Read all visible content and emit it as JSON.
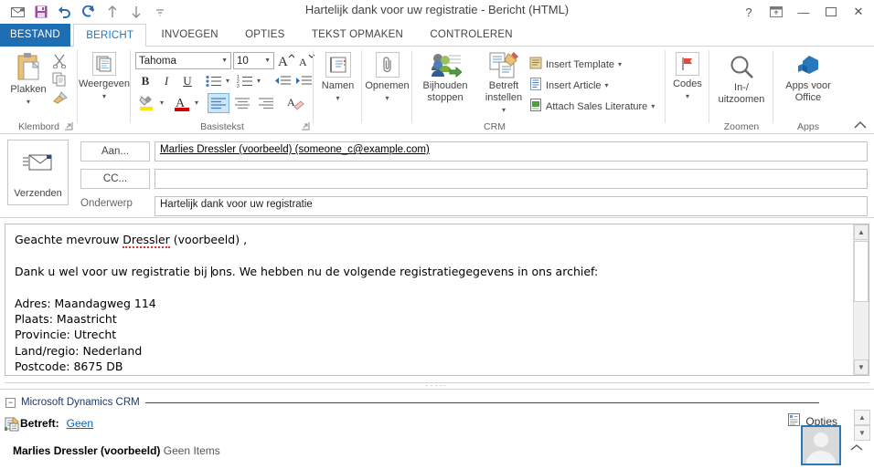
{
  "window": {
    "title": "Hartelijk dank voor uw registratie - Bericht (HTML)",
    "quick_access": [
      {
        "name": "message-icon",
        "glyph": "✉"
      },
      {
        "name": "save-icon",
        "glyph": "▣"
      },
      {
        "name": "undo-icon",
        "glyph": "↶"
      },
      {
        "name": "redo-icon",
        "glyph": "↻"
      },
      {
        "name": "previous-item-icon",
        "glyph": "↑"
      },
      {
        "name": "next-item-icon",
        "glyph": "↓"
      },
      {
        "name": "customize-quick-access-icon",
        "glyph": "⨍"
      }
    ],
    "controls": {
      "help": "?",
      "ribbon_display": "⧉",
      "minimize": "—",
      "maximize": "❐",
      "close": "✕"
    }
  },
  "tabs": {
    "file": "BESTAND",
    "items": [
      {
        "label": "BERICHT",
        "active": true
      },
      {
        "label": "INVOEGEN",
        "active": false
      },
      {
        "label": "OPTIES",
        "active": false
      },
      {
        "label": "TEKST OPMAKEN",
        "active": false
      },
      {
        "label": "CONTROLEREN",
        "active": false
      }
    ]
  },
  "ribbon": {
    "clipboard": {
      "group_label": "Klembord",
      "paste_label": "Plakken",
      "cut_label": "Knippen",
      "copy_label": "Kopiëren",
      "format_painter_label": "Opmaak kopiëren/plakken",
      "dialog_launcher": "⤵"
    },
    "show": {
      "button_label": "Weergeven"
    },
    "basic_text": {
      "group_label": "Basistekst",
      "font_name": "Tahoma",
      "font_size": "10",
      "grow_font": "A",
      "shrink_font": "A",
      "bold": "B",
      "italic": "I",
      "underline": "U",
      "bullets": "bullet-list",
      "numbering": "numbered-list",
      "decrease_indent": "decrease-indent",
      "increase_indent": "increase-indent",
      "highlight": "text-highlight",
      "font_color": "A",
      "align_left": "align-left",
      "align_center": "align-center",
      "align_right": "align-right",
      "clear_formatting": "clear-formatting",
      "dialog_launcher": "⤵"
    },
    "names": {
      "button_label": "Namen"
    },
    "include": {
      "button_label": "Opnemen"
    },
    "crm": {
      "group_label": "CRM",
      "track_label_line1": "Bijhouden",
      "track_label_line2": "stoppen",
      "regarding_line1": "Betreft",
      "regarding_line2": "instellen",
      "items": [
        {
          "label": "Insert Template",
          "icon": "template-icon"
        },
        {
          "label": "Insert Article",
          "icon": "article-icon"
        },
        {
          "label": "Attach Sales Literature",
          "icon": "sales-literature-icon"
        }
      ],
      "codes_label": "Codes"
    },
    "zoom": {
      "group_label": "Zoomen",
      "button_line1": "In-/",
      "button_line2": "uitzoomen"
    },
    "apps": {
      "group_label": "Apps",
      "button_line1": "Apps voor",
      "button_line2": "Office"
    },
    "collapse_ribbon": "⌃"
  },
  "compose": {
    "send_label": "Verzenden",
    "to_button": "Aan...",
    "cc_button": "CC...",
    "subject_label": "Onderwerp",
    "to_value": "Marlies Dressler (voorbeeld) (someone_c@example.com)",
    "cc_value": "",
    "subject_value": "Hartelijk dank voor uw registratie"
  },
  "body": {
    "greeting_pre": "Geachte mevrouw ",
    "greeting_name": "Dressler",
    "greeting_post": " (voorbeeld) ,",
    "paragraph_pre": "Dank u wel voor uw registratie bij ",
    "paragraph_post": "ons. We hebben nu de volgende registratiegegevens in ons archief:",
    "details": [
      "Adres: Maandagweg 114",
      "Plaats: Maastricht",
      "Provincie: Utrecht",
      "Land/regio: Nederland",
      "Postcode: 8675 DB"
    ]
  },
  "crm_pane": {
    "title": "Microsoft Dynamics CRM",
    "collapse_glyph": "−",
    "regarding_label": "Betreft:",
    "regarding_value": "Geen",
    "contact_name": "Marlies Dressler (voorbeeld)",
    "contact_items": "Geen Items",
    "options_label": "Opties",
    "scroll_up": "▲",
    "scroll_down": "▼",
    "expand_glyph": "⌃"
  },
  "colors": {
    "accent_blue": "#1e6eb4",
    "active_tab": "#1b7ac4",
    "link_blue": "#0563c1",
    "crm_title": "#1f3864",
    "spell_error": "#e03131",
    "selection": "#cde6f7"
  }
}
